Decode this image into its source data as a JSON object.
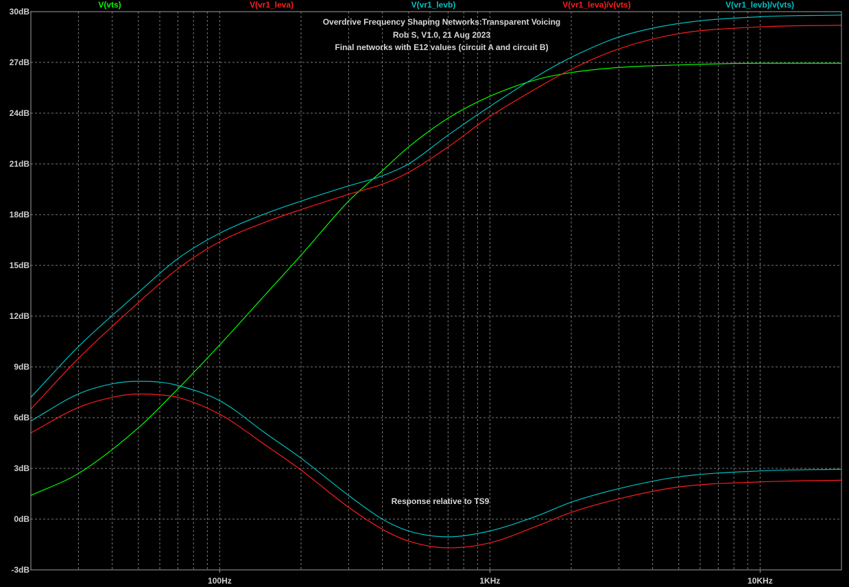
{
  "chart_data": {
    "type": "line",
    "title": [
      "Overdrive Frequency Shaping Networks:Transparent Voicing",
      "Rob S, V1.0, 21 Aug 2023",
      "Final networks with E12 values (circuit A and circuit B)"
    ],
    "annotation": "Response relative to TS9",
    "xscale": "log",
    "xlim": [
      20,
      20000
    ],
    "ylim": [
      -3,
      30
    ],
    "x_ticks": [
      {
        "value": 100,
        "label": "100Hz"
      },
      {
        "value": 1000,
        "label": "1KHz"
      },
      {
        "value": 10000,
        "label": "10KHz"
      }
    ],
    "y_ticks": [
      {
        "value": 30,
        "label": "30dB"
      },
      {
        "value": 27,
        "label": "27dB"
      },
      {
        "value": 24,
        "label": "24dB"
      },
      {
        "value": 21,
        "label": "21dB"
      },
      {
        "value": 18,
        "label": "18dB"
      },
      {
        "value": 15,
        "label": "15dB"
      },
      {
        "value": 12,
        "label": "12dB"
      },
      {
        "value": 9,
        "label": "9dB"
      },
      {
        "value": 6,
        "label": "6dB"
      },
      {
        "value": 3,
        "label": "3dB"
      },
      {
        "value": 0,
        "label": "0dB"
      },
      {
        "value": -3,
        "label": "-3dB"
      }
    ],
    "grid": true,
    "background_color": "#000000",
    "axis_color": "#a0a0a0",
    "grid_color": "#7a7a7a",
    "series": [
      {
        "name": "V(vts)",
        "color": "#00ff00",
        "x": [
          20,
          30,
          50,
          70,
          100,
          150,
          200,
          300,
          400,
          500,
          700,
          1000,
          1500,
          2000,
          3000,
          5000,
          10000,
          20000
        ],
        "y": [
          1.4,
          2.7,
          5.4,
          7.7,
          10.3,
          13.4,
          15.6,
          18.8,
          20.6,
          22.0,
          23.7,
          25.0,
          26.0,
          26.4,
          26.7,
          26.85,
          26.95,
          26.95
        ]
      },
      {
        "name": "V(vr1_leva)",
        "color": "#ff1c1c",
        "x": [
          20,
          30,
          50,
          70,
          100,
          150,
          200,
          300,
          400,
          500,
          700,
          1000,
          1500,
          2000,
          3000,
          5000,
          10000,
          20000
        ],
        "y": [
          6.5,
          9.5,
          12.8,
          14.8,
          16.4,
          17.6,
          18.3,
          19.2,
          19.8,
          20.5,
          22.0,
          23.8,
          25.5,
          26.6,
          27.8,
          28.7,
          29.1,
          29.2
        ]
      },
      {
        "name": "V(vr1_levb)",
        "color": "#00c0c0",
        "x": [
          20,
          30,
          50,
          70,
          100,
          150,
          200,
          300,
          400,
          500,
          700,
          1000,
          1500,
          2000,
          3000,
          5000,
          10000,
          20000
        ],
        "y": [
          7.2,
          10.2,
          13.4,
          15.4,
          16.9,
          18.1,
          18.8,
          19.7,
          20.3,
          21.0,
          22.7,
          24.4,
          26.2,
          27.3,
          28.5,
          29.3,
          29.7,
          29.8
        ]
      },
      {
        "name": "V(vr1_leva)/v(vts)",
        "color": "#ff1c1c",
        "x": [
          20,
          30,
          40,
          50,
          60,
          70,
          100,
          150,
          200,
          300,
          400,
          500,
          700,
          1000,
          1500,
          2000,
          3000,
          5000,
          10000,
          20000
        ],
        "y": [
          5.1,
          6.6,
          7.2,
          7.4,
          7.35,
          7.2,
          6.2,
          4.3,
          2.9,
          0.7,
          -0.6,
          -1.3,
          -1.7,
          -1.4,
          -0.4,
          0.4,
          1.2,
          1.9,
          2.2,
          2.3
        ]
      },
      {
        "name": "V(vr1_levb)/v(vts)",
        "color": "#00c0c0",
        "x": [
          20,
          30,
          40,
          50,
          60,
          70,
          100,
          150,
          200,
          300,
          400,
          500,
          700,
          1000,
          1500,
          2000,
          3000,
          5000,
          10000,
          20000
        ],
        "y": [
          5.8,
          7.4,
          8.0,
          8.15,
          8.1,
          7.9,
          7.0,
          5.0,
          3.6,
          1.4,
          0.0,
          -0.7,
          -1.05,
          -0.7,
          0.2,
          1.0,
          1.8,
          2.5,
          2.85,
          2.95
        ]
      }
    ]
  }
}
